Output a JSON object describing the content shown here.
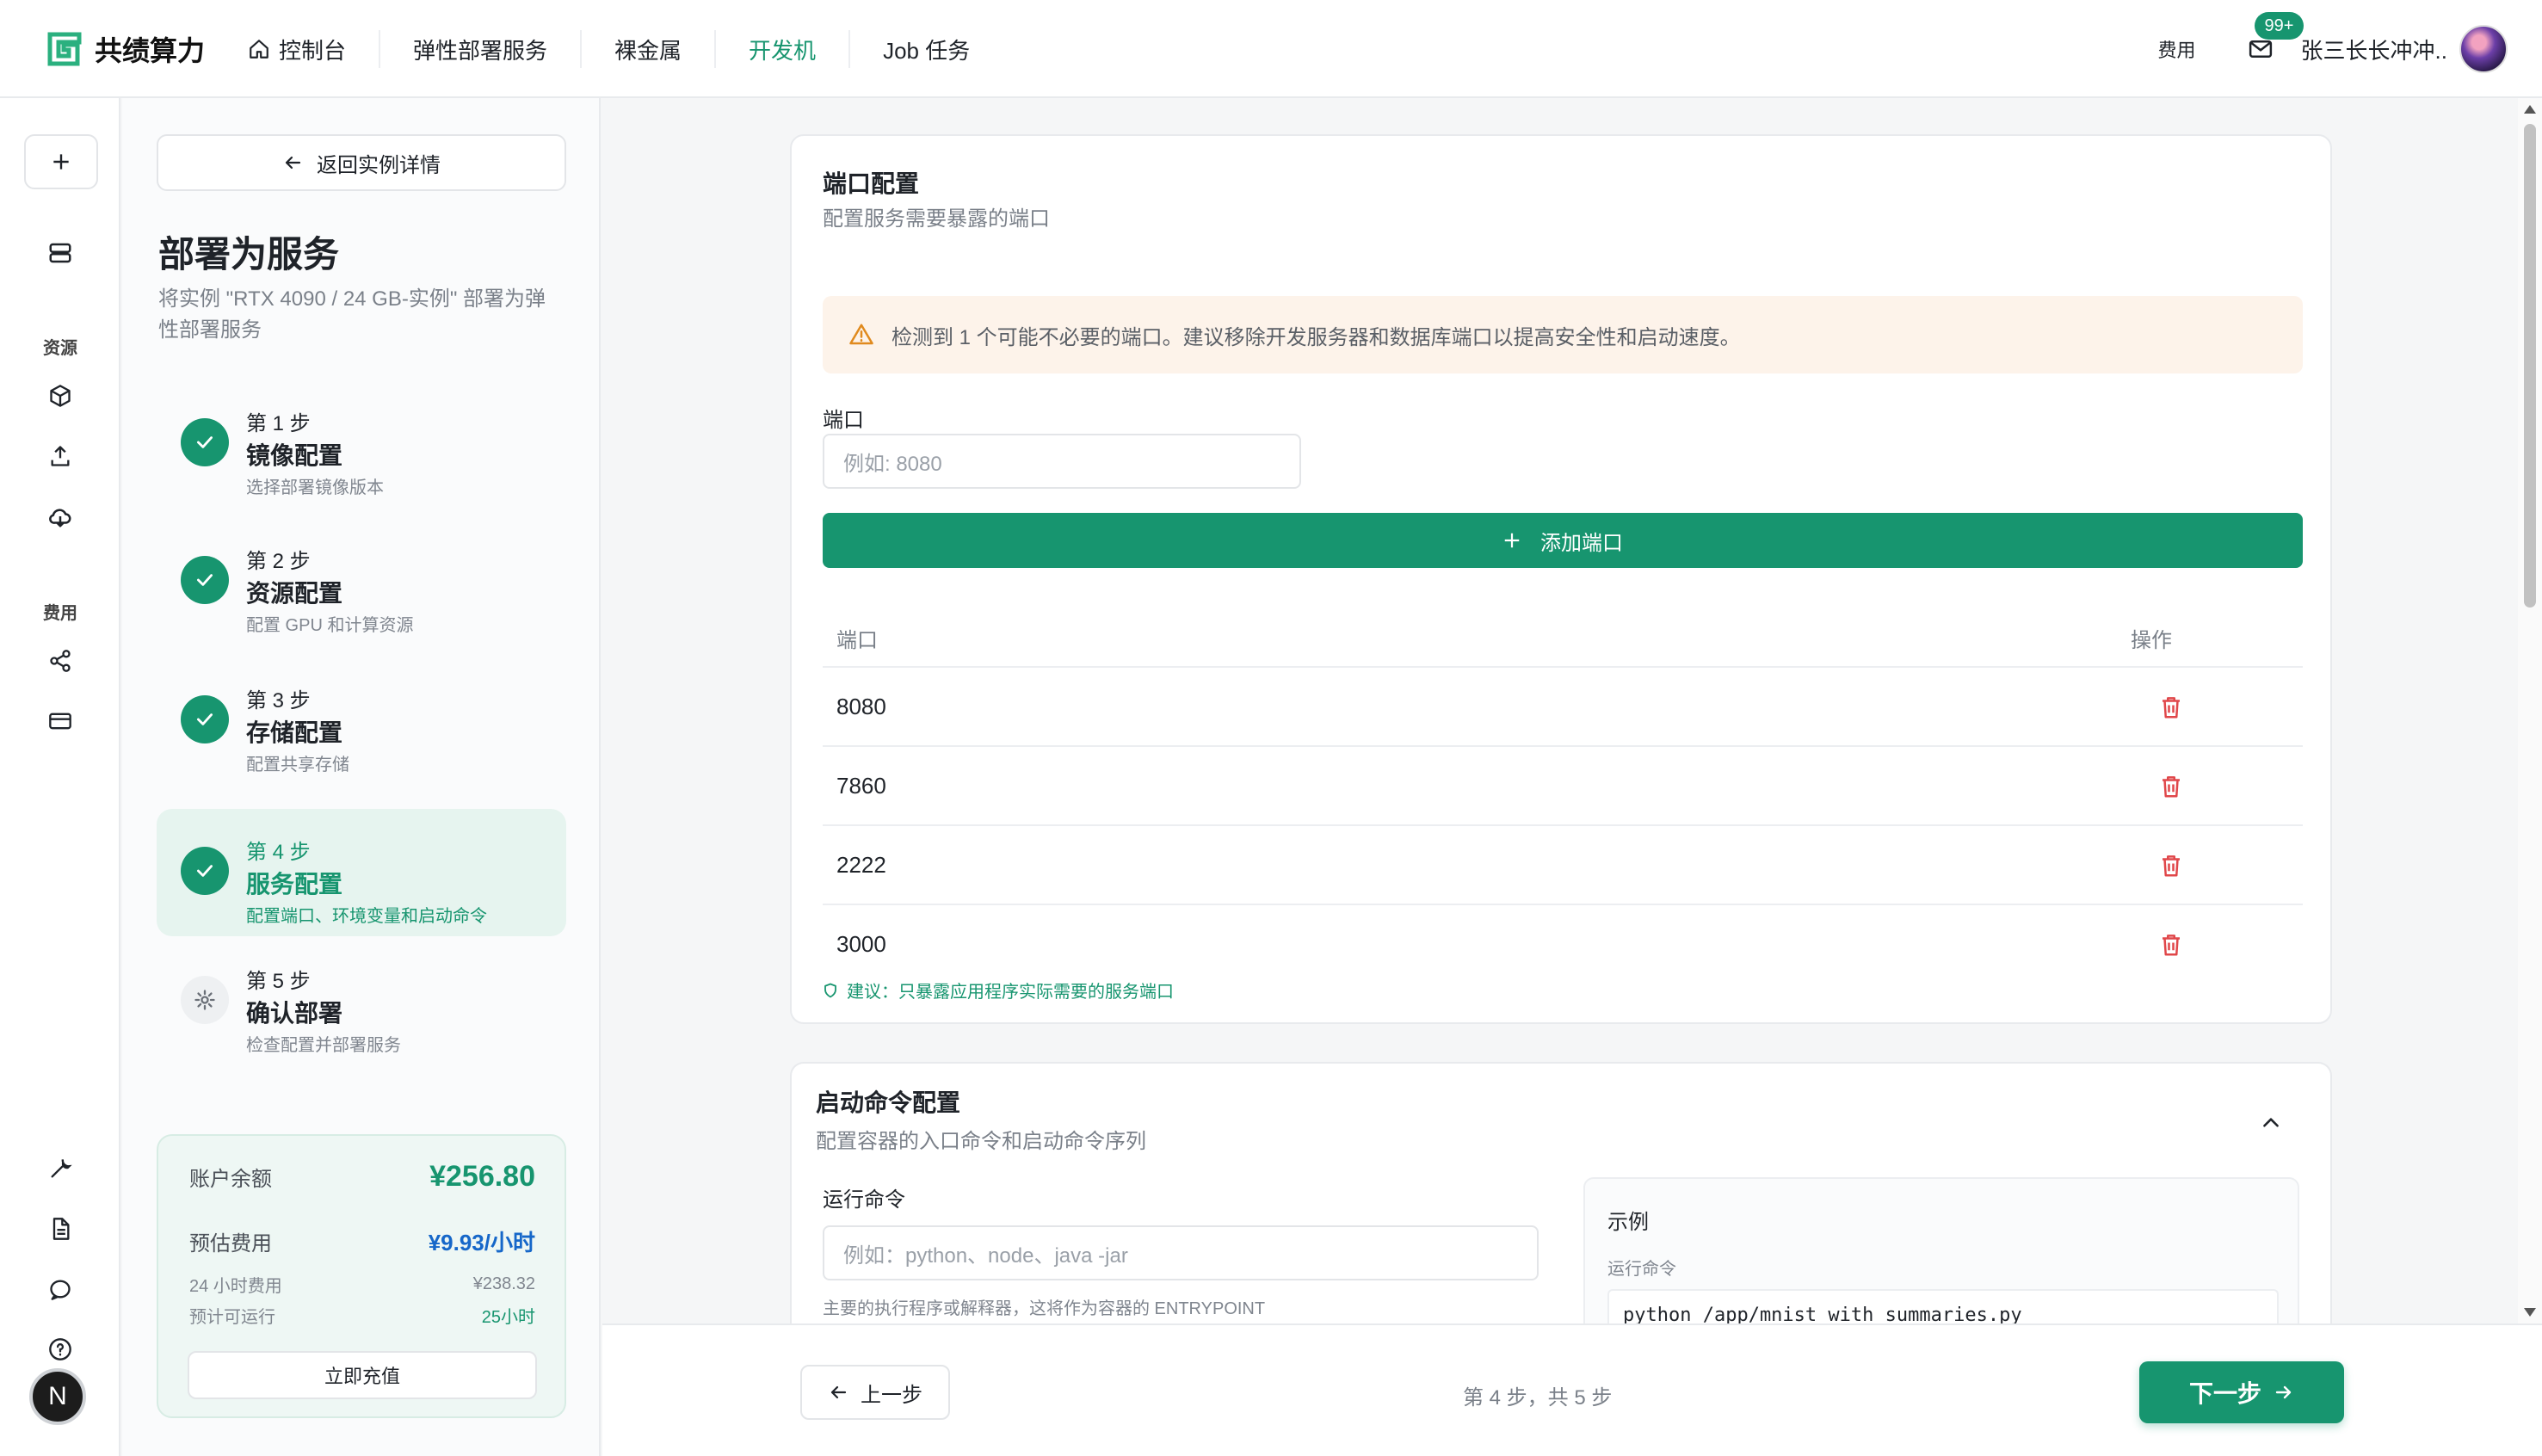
{
  "brand": {
    "name": "共绩算力",
    "accent": "#17956f"
  },
  "nav": {
    "items": [
      {
        "label": "控制台",
        "icon": "home-icon"
      },
      {
        "label": "弹性部署服务"
      },
      {
        "label": "裸金属"
      },
      {
        "label": "开发机",
        "active": true
      },
      {
        "label": "Job 任务"
      }
    ]
  },
  "header": {
    "fee_label": "费用",
    "mail_badge": "99+",
    "username": "张三长长冲冲.."
  },
  "rail": {
    "section_resources": "资源",
    "section_fees": "费用",
    "avatar_letter": "N"
  },
  "steps_panel": {
    "back_label": "返回实例详情",
    "title": "部署为服务",
    "subtitle": "将实例 \"RTX 4090 / 24 GB-实例\" 部署为弹性部署服务",
    "steps": [
      {
        "num": "第 1 步",
        "name": "镜像配置",
        "desc": "选择部署镜像版本",
        "status": "done"
      },
      {
        "num": "第 2 步",
        "name": "资源配置",
        "desc": "配置 GPU 和计算资源",
        "status": "done"
      },
      {
        "num": "第 3 步",
        "name": "存储配置",
        "desc": "配置共享存储",
        "status": "done"
      },
      {
        "num": "第 4 步",
        "name": "服务配置",
        "desc": "配置端口、环境变量和启动命令",
        "status": "active"
      },
      {
        "num": "第 5 步",
        "name": "确认部署",
        "desc": "检查配置并部署服务",
        "status": "pending"
      }
    ]
  },
  "balance": {
    "balance_label": "账户余额",
    "balance_value": "¥256.80",
    "est_label": "预估费用",
    "est_value": "¥9.93/小时",
    "day_label": "24 小时费用",
    "day_value": "¥238.32",
    "runtime_label": "预计可运行",
    "runtime_value": "25小时",
    "recharge_label": "立即充值"
  },
  "port_card": {
    "title": "端口配置",
    "subtitle": "配置服务需要暴露的端口",
    "warning": "检测到 1 个可能不必要的端口。建议移除开发服务器和数据库端口以提高安全性和启动速度。",
    "field_label": "端口",
    "placeholder": "例如: 8080",
    "add_label": "添加端口",
    "col_port": "端口",
    "col_action": "操作",
    "ports": [
      "8080",
      "7860",
      "2222",
      "3000"
    ],
    "tip": "建议：只暴露应用程序实际需要的服务端口"
  },
  "cmd_card": {
    "title": "启动命令配置",
    "subtitle": "配置容器的入口命令和启动命令序列",
    "run_label": "运行命令",
    "run_placeholder": "例如：python、node、java -jar",
    "run_hint": "主要的执行程序或解释器，这将作为容器的 ENTRYPOINT",
    "example_title": "示例",
    "example_label": "运行命令",
    "example_code": "python /app/mnist_with_summaries.py"
  },
  "footer": {
    "prev_label": "上一步",
    "progress": "第 4 步，共 5 步",
    "next_label": "下一步"
  }
}
